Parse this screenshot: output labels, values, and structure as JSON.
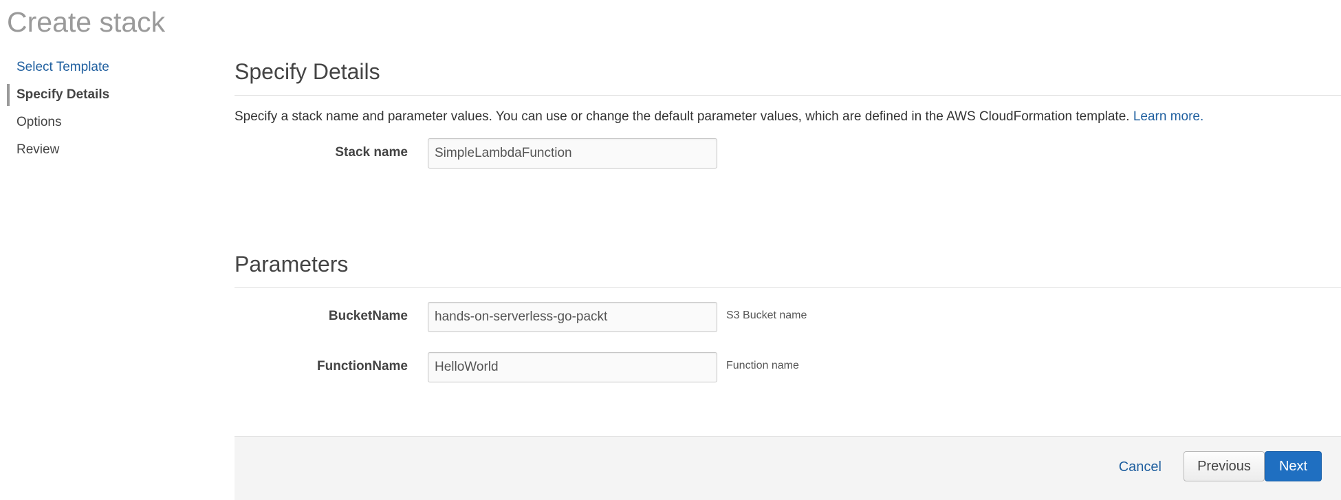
{
  "page": {
    "title": "Create stack"
  },
  "steps": [
    {
      "label": "Select Template",
      "state": "link"
    },
    {
      "label": "Specify Details",
      "state": "active"
    },
    {
      "label": "Options",
      "state": "pending"
    },
    {
      "label": "Review",
      "state": "pending"
    }
  ],
  "details": {
    "heading": "Specify Details",
    "intro": "Specify a stack name and parameter values. You can use or change the default parameter values, which are defined in the AWS CloudFormation template.",
    "learn_more": "Learn more.",
    "stack_name_label": "Stack name",
    "stack_name_value": "SimpleLambdaFunction"
  },
  "parameters": {
    "heading": "Parameters",
    "fields": [
      {
        "label": "BucketName",
        "value": "hands-on-serverless-go-packt",
        "hint": "S3 Bucket name"
      },
      {
        "label": "FunctionName",
        "value": "HelloWorld",
        "hint": "Function name"
      }
    ]
  },
  "footer": {
    "cancel_label": "Cancel",
    "previous_label": "Previous",
    "next_label": "Next"
  },
  "colors": {
    "link": "#1f5f9f",
    "primary_button": "#1f6fc1",
    "footer_background": "#f4f4f4"
  }
}
